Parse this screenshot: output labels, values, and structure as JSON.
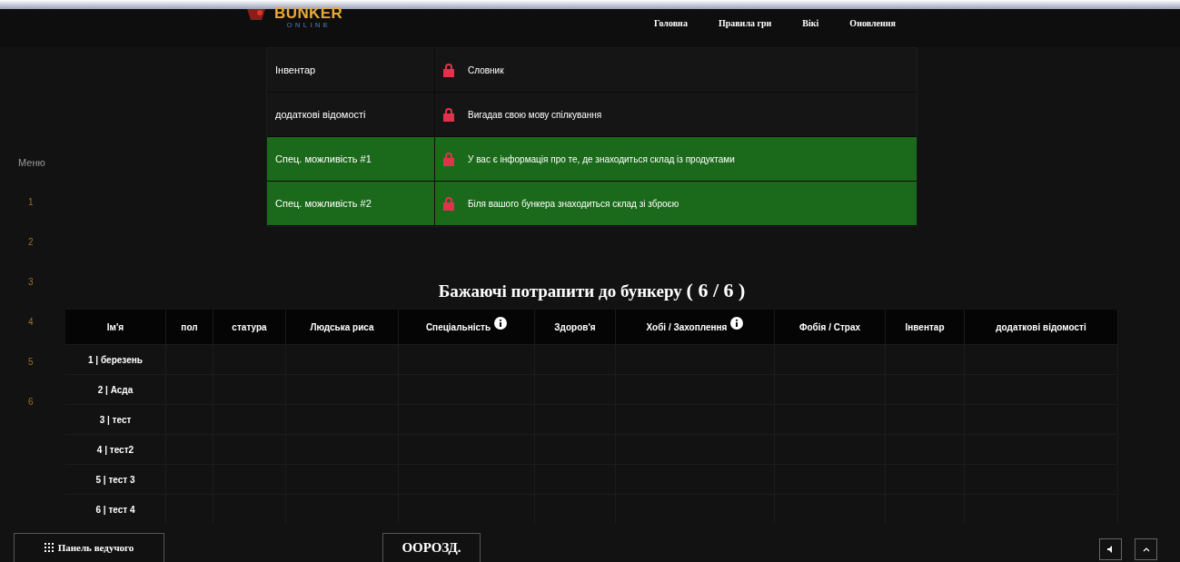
{
  "logo": {
    "title": "BUNKER",
    "subtitle": "ONLINE"
  },
  "nav": [
    "Головна",
    "Правила гри",
    "Вікі",
    "Оновлення"
  ],
  "menu": {
    "title": "Меню",
    "items": [
      "1",
      "2",
      "3",
      "4",
      "5",
      "6"
    ]
  },
  "cards": [
    {
      "label": "Інвентар",
      "value": "Словник",
      "highlighted": false
    },
    {
      "label": "додаткові відомості",
      "value": "Вигадав свою мову спілкування",
      "highlighted": false
    },
    {
      "label": "Спец. можливість #1",
      "value": "У вас є інформація про те, де знаходиться склад із продуктами",
      "highlighted": true
    },
    {
      "label": "Спец. можливість #2",
      "value": "Біля вашого бункера знаходиться склад зі зброєю",
      "highlighted": true
    }
  ],
  "heading": "Бажаючі потрапити до бункеру",
  "count": "( 6 / 6 )",
  "table": {
    "columns": [
      {
        "label": "Ім'я",
        "info": false
      },
      {
        "label": "пол",
        "info": false
      },
      {
        "label": "статура",
        "info": false
      },
      {
        "label": "Людська риса",
        "info": false
      },
      {
        "label": "Спеціальність",
        "info": true
      },
      {
        "label": "Здоров'я",
        "info": false
      },
      {
        "label": "Хобі / Захоплення",
        "info": true
      },
      {
        "label": "Фобія / Страх",
        "info": false
      },
      {
        "label": "Інвентар",
        "info": false
      },
      {
        "label": "додаткові відомості",
        "info": false
      }
    ],
    "rows": [
      {
        "name": "1 | березень"
      },
      {
        "name": "2 | Асда"
      },
      {
        "name": "3 | тест"
      },
      {
        "name": "4 | тест2"
      },
      {
        "name": "5 | тест 3"
      },
      {
        "name": "6 | тест 4"
      }
    ]
  },
  "host_panel": "Панель ведучого",
  "center_button": "ООРОЗД."
}
